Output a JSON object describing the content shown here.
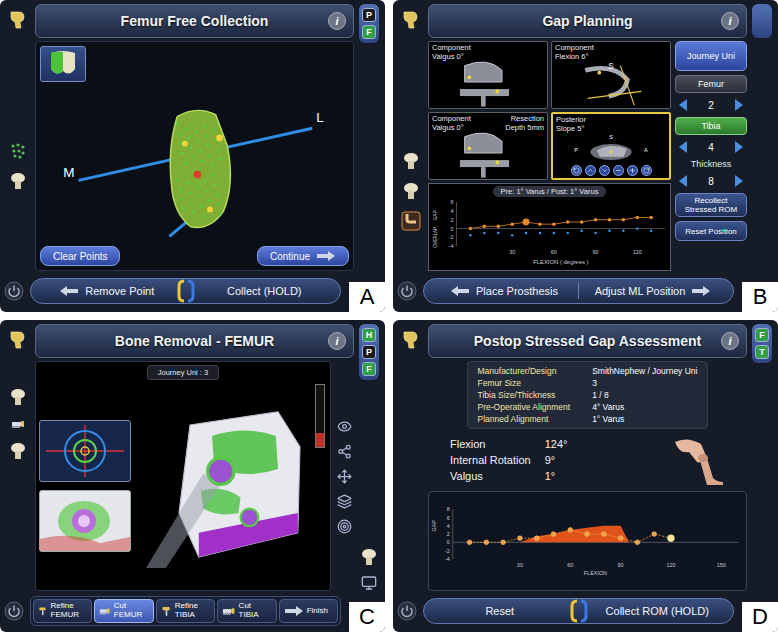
{
  "panels": {
    "a": {
      "label": "A",
      "title": "Femur Free Collection",
      "info": "i",
      "badges": [
        {
          "text": "P",
          "color": "#1b1b1b"
        },
        {
          "text": "F",
          "color": "#2f9e44"
        }
      ],
      "axis": {
        "medial": "M",
        "lateral": "L"
      },
      "actions": [
        {
          "label": "Clear Points",
          "kind": "plain"
        },
        {
          "label": "Continue",
          "kind": "next"
        }
      ],
      "footer": {
        "kind": "hold",
        "buttons": [
          {
            "label": "Remove Point",
            "kind": "back"
          },
          {
            "label": "Collect (HOLD)",
            "kind": "plain"
          }
        ]
      }
    },
    "b": {
      "label": "B",
      "title": "Gap Planning",
      "info": "i",
      "badges": [],
      "viewports": [
        {
          "kind": "coronal",
          "lines": [
            "Component",
            "Valgus 0°"
          ],
          "extra": [],
          "marks": [],
          "controls": false,
          "selected": false
        },
        {
          "kind": "sagittal",
          "lines": [
            "Component",
            "Flexion 6°"
          ],
          "extra": [],
          "marks": [
            "S"
          ],
          "controls": false,
          "selected": false
        },
        {
          "kind": "coronal",
          "lines": [
            "Component",
            "Valgus 0°"
          ],
          "extra": [
            "Resection",
            "Depth 5mm"
          ],
          "marks": [],
          "controls": false,
          "selected": false
        },
        {
          "kind": "axial",
          "lines": [
            "Posterior",
            "Slope 5°"
          ],
          "extra": [],
          "marks": [
            "S",
            "P",
            "A"
          ],
          "controls": true,
          "selected": true
        }
      ],
      "implant": "Journey Uni",
      "femur": {
        "label": "Femur",
        "size": "2",
        "selected": false
      },
      "tibia": {
        "label": "Tibia",
        "size": "4",
        "selected": true
      },
      "thickness": {
        "label": "Thickness",
        "value": "8"
      },
      "buttons": [
        "Recollect Stressed ROM",
        "Reset Position"
      ],
      "chart": {
        "caption": "Pre: 1° Varus / Post: 1° Varus",
        "y_labels": [
          "GAP",
          "OVERLAP"
        ],
        "x_title": "FLEXION ( degrees )",
        "x_ticks": [
          "30",
          "60",
          "90",
          "120"
        ],
        "y_ticks": [
          "6",
          "4",
          "2",
          "0",
          "-2",
          "-4"
        ],
        "flexion": [
          0,
          10,
          20,
          30,
          40,
          50,
          60,
          70,
          80,
          90,
          100,
          110,
          120,
          130
        ],
        "gap": [
          0,
          0.5,
          0.5,
          1,
          1.5,
          1,
          1,
          1.5,
          1.5,
          2,
          2,
          2,
          2.5,
          2.5
        ],
        "overlap": [
          -1.5,
          -1,
          -1,
          -1.5,
          -1,
          -1,
          -1,
          -1,
          -0.5,
          -1,
          -0.5,
          -0.5,
          0,
          -0.5
        ],
        "highlight": 4
      },
      "footer": {
        "kind": "nav",
        "buttons": [
          {
            "label": "Place Prosthesis",
            "kind": "back"
          },
          {
            "label": "Adjust ML Position",
            "kind": "next"
          }
        ]
      }
    },
    "c": {
      "label": "C",
      "title": "Bone Removal - FEMUR",
      "info": "i",
      "badges": [
        {
          "text": "H",
          "color": "#2f9e44"
        },
        {
          "text": "P",
          "color": "#1b1b1b"
        },
        {
          "text": "F",
          "color": "#2f9e44"
        }
      ],
      "subtitle": "Journey Uni : 3",
      "gauge": {
        "level": 0.22
      },
      "steps": [
        {
          "label": "Refine FEMUR",
          "kind": "refine",
          "selected": false
        },
        {
          "label": "Cut FEMUR",
          "kind": "cut",
          "selected": true
        },
        {
          "label": "Refine TIBIA",
          "kind": "refine",
          "selected": false
        },
        {
          "label": "Cut TIBIA",
          "kind": "cut",
          "selected": false
        },
        {
          "label": "Finish",
          "kind": "finish",
          "selected": false
        }
      ]
    },
    "d": {
      "label": "D",
      "title": "Postop Stressed Gap Assessment",
      "info": "i",
      "badges": [
        {
          "text": "F",
          "color": "#2f9e44"
        },
        {
          "text": "T",
          "color": "#2f9e44"
        }
      ],
      "summary": [
        {
          "key": "Manufacturer/Design",
          "value": "SmithNephew / Journey Uni"
        },
        {
          "key": "Femur Size",
          "value": "3"
        },
        {
          "key": "Tibia Size/Thickness",
          "value": "1 / 8"
        },
        {
          "key": "Pre-Operative Alignment",
          "value": "4° Varus"
        },
        {
          "key": "Planned Alignment",
          "value": "1° Varus"
        }
      ],
      "readings": [
        {
          "name": "Flexion",
          "value": "124°"
        },
        {
          "name": "Internal Rotation",
          "value": "9°"
        },
        {
          "name": "Valgus",
          "value": "1°"
        }
      ],
      "chart": {
        "y_title": "GAP",
        "x_title": "FLEXION",
        "y_ticks": [
          "8",
          "6",
          "4",
          "2",
          "0",
          "-2",
          "-4"
        ],
        "x_ticks": [
          "30",
          "60",
          "90",
          "120",
          "150"
        ],
        "flexion": [
          0,
          10,
          20,
          30,
          40,
          50,
          60,
          70,
          80,
          90,
          100,
          110,
          120
        ],
        "gap": [
          0,
          0,
          0,
          1,
          1,
          2,
          3,
          2,
          2,
          1,
          0,
          2,
          1
        ],
        "highlight": 12,
        "area_flexion": [
          30,
          40,
          50,
          60,
          70,
          80,
          90,
          95
        ],
        "area": [
          0,
          1.5,
          2,
          3,
          3.5,
          4,
          4,
          0
        ]
      },
      "footer": {
        "kind": "hold",
        "buttons": [
          {
            "label": "Reset",
            "kind": "plain"
          },
          {
            "label": "Collect ROM (HOLD)",
            "kind": "plain"
          }
        ]
      }
    }
  }
}
